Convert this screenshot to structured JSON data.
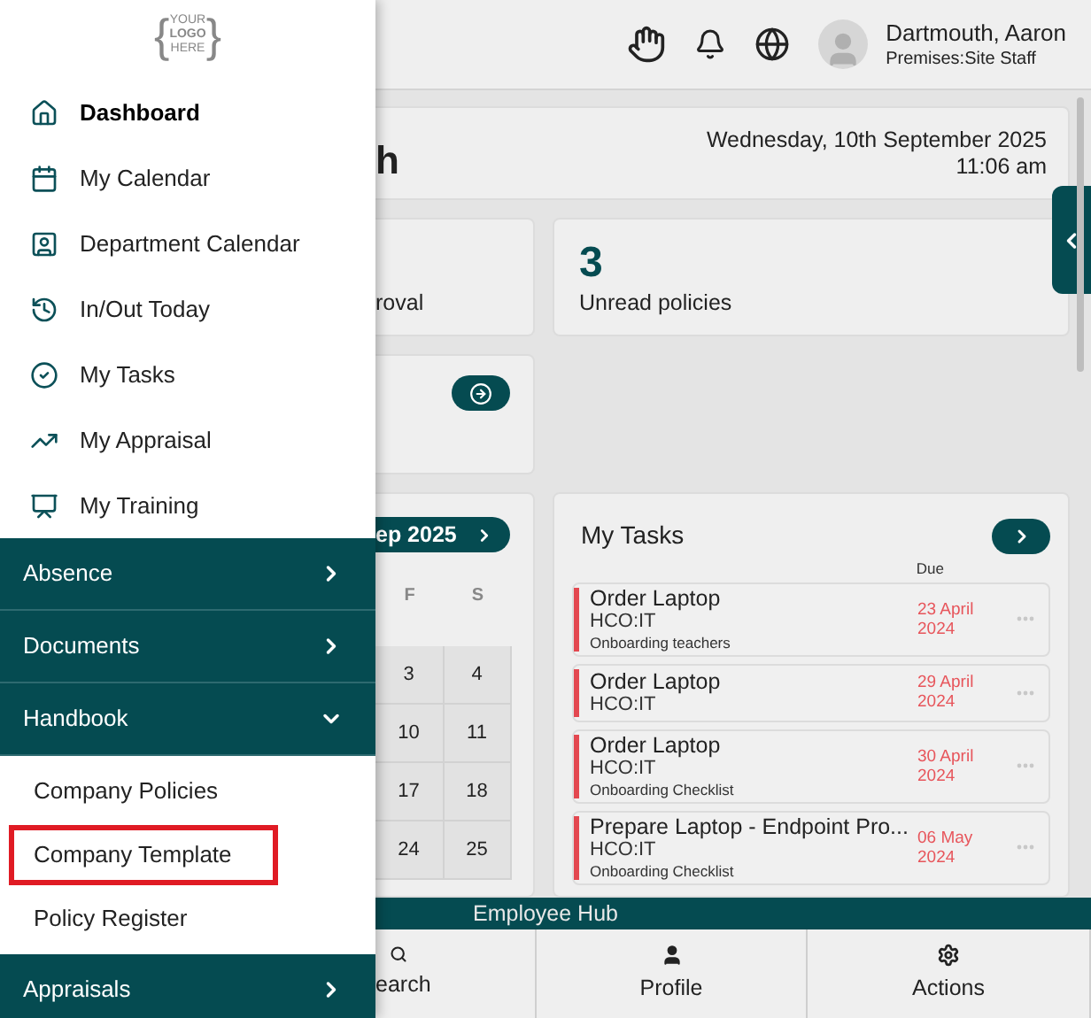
{
  "sidebar": {
    "logo": {
      "open": "{",
      "lines": [
        "YOUR",
        "LOGO",
        "HERE"
      ],
      "close": "}"
    },
    "items": [
      {
        "kind": "home",
        "label": "Dashboard",
        "selected": true
      },
      {
        "kind": "calendar",
        "label": "My Calendar",
        "selected": false
      },
      {
        "kind": "badge",
        "label": "Department Calendar",
        "selected": false
      },
      {
        "kind": "clock",
        "label": "In/Out Today",
        "selected": false
      },
      {
        "kind": "check",
        "label": "My Tasks",
        "selected": false
      },
      {
        "kind": "trend",
        "label": "My Appraisal",
        "selected": false
      },
      {
        "kind": "training",
        "label": "My Training",
        "selected": false
      }
    ],
    "groups": [
      {
        "label": "Absence",
        "expanded": false
      },
      {
        "label": "Documents",
        "expanded": false
      },
      {
        "label": "Handbook",
        "expanded": true,
        "children": [
          {
            "label": "Company Policies",
            "highlighted": false
          },
          {
            "label": "Company Template",
            "highlighted": true
          },
          {
            "label": "Policy Register",
            "highlighted": false
          }
        ]
      },
      {
        "label": "Appraisals",
        "expanded": false
      }
    ]
  },
  "header": {
    "user_name": "Dartmouth, Aaron",
    "user_role": "Premises:Site Staff"
  },
  "welcome": {
    "title_fragment": "h",
    "date": "Wednesday, 10th September 2025",
    "time": "11:06 am"
  },
  "stats": [
    {
      "label": "roval"
    },
    {
      "value": "3",
      "label": "Unread policies"
    }
  ],
  "calendar": {
    "month_fragment": "ep 2025",
    "days": [
      "F",
      "S"
    ],
    "rows": [
      [
        "3",
        "4"
      ],
      [
        "10",
        "11"
      ],
      [
        "17",
        "18"
      ],
      [
        "24",
        "25"
      ]
    ]
  },
  "tasks": {
    "title": "My Tasks",
    "due_heading": "Due",
    "items": [
      {
        "title": "Order Laptop",
        "group": "HCO:IT",
        "subtitle": "Onboarding teachers",
        "due": "23 April 2024"
      },
      {
        "title": "Order Laptop",
        "group": "HCO:IT",
        "due": "29 April 2024"
      },
      {
        "title": "Order Laptop",
        "group": "HCO:IT",
        "subtitle": "Onboarding Checklist",
        "due": "30 April 2024"
      },
      {
        "title": "Prepare Laptop - Endpoint Pro...",
        "group": "HCO:IT",
        "subtitle": "Onboarding Checklist",
        "due": "06 May 2024"
      }
    ]
  },
  "footer": {
    "title": "Employee Hub",
    "nav": [
      {
        "kind": "search",
        "label": "earch"
      },
      {
        "kind": "profile",
        "label": "Profile"
      },
      {
        "kind": "actions",
        "label": "Actions"
      }
    ]
  }
}
